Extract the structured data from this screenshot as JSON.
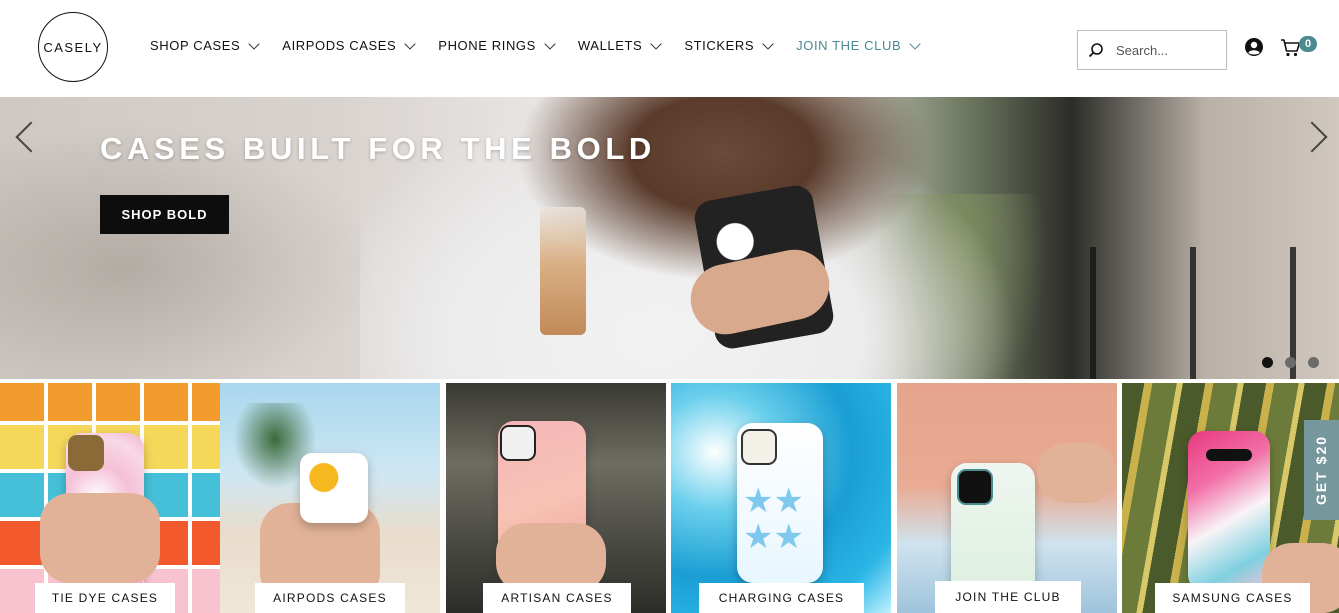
{
  "header": {
    "logo_text": "CASELY",
    "nav": [
      {
        "label": "SHOP CASES"
      },
      {
        "label": "AIRPODS CASES"
      },
      {
        "label": "PHONE RINGS"
      },
      {
        "label": "WALLETS"
      },
      {
        "label": "STICKERS"
      },
      {
        "label": "JOIN THE CLUB"
      }
    ],
    "search_placeholder": "Search...",
    "cart_count": "0",
    "accent_color": "#4a8a91"
  },
  "hero": {
    "title": "CASES BUILT FOR THE BOLD",
    "button_label": "SHOP BOLD",
    "slide_count": 3,
    "active_slide": 1
  },
  "tiles": [
    {
      "label": "TIE DYE CASES"
    },
    {
      "label": "AIRPODS CASES"
    },
    {
      "label": "ARTISAN CASES"
    },
    {
      "label": "CHARGING CASES"
    },
    {
      "label": "JOIN THE CLUB"
    },
    {
      "label": "SAMSUNG CASES"
    }
  ],
  "side_tab": {
    "label": "GET $20",
    "color": "#76979c"
  },
  "icons": {
    "search": "search-icon",
    "account": "account-icon",
    "cart": "cart-icon",
    "prev": "chevron-left-icon",
    "next": "chevron-right-icon"
  }
}
